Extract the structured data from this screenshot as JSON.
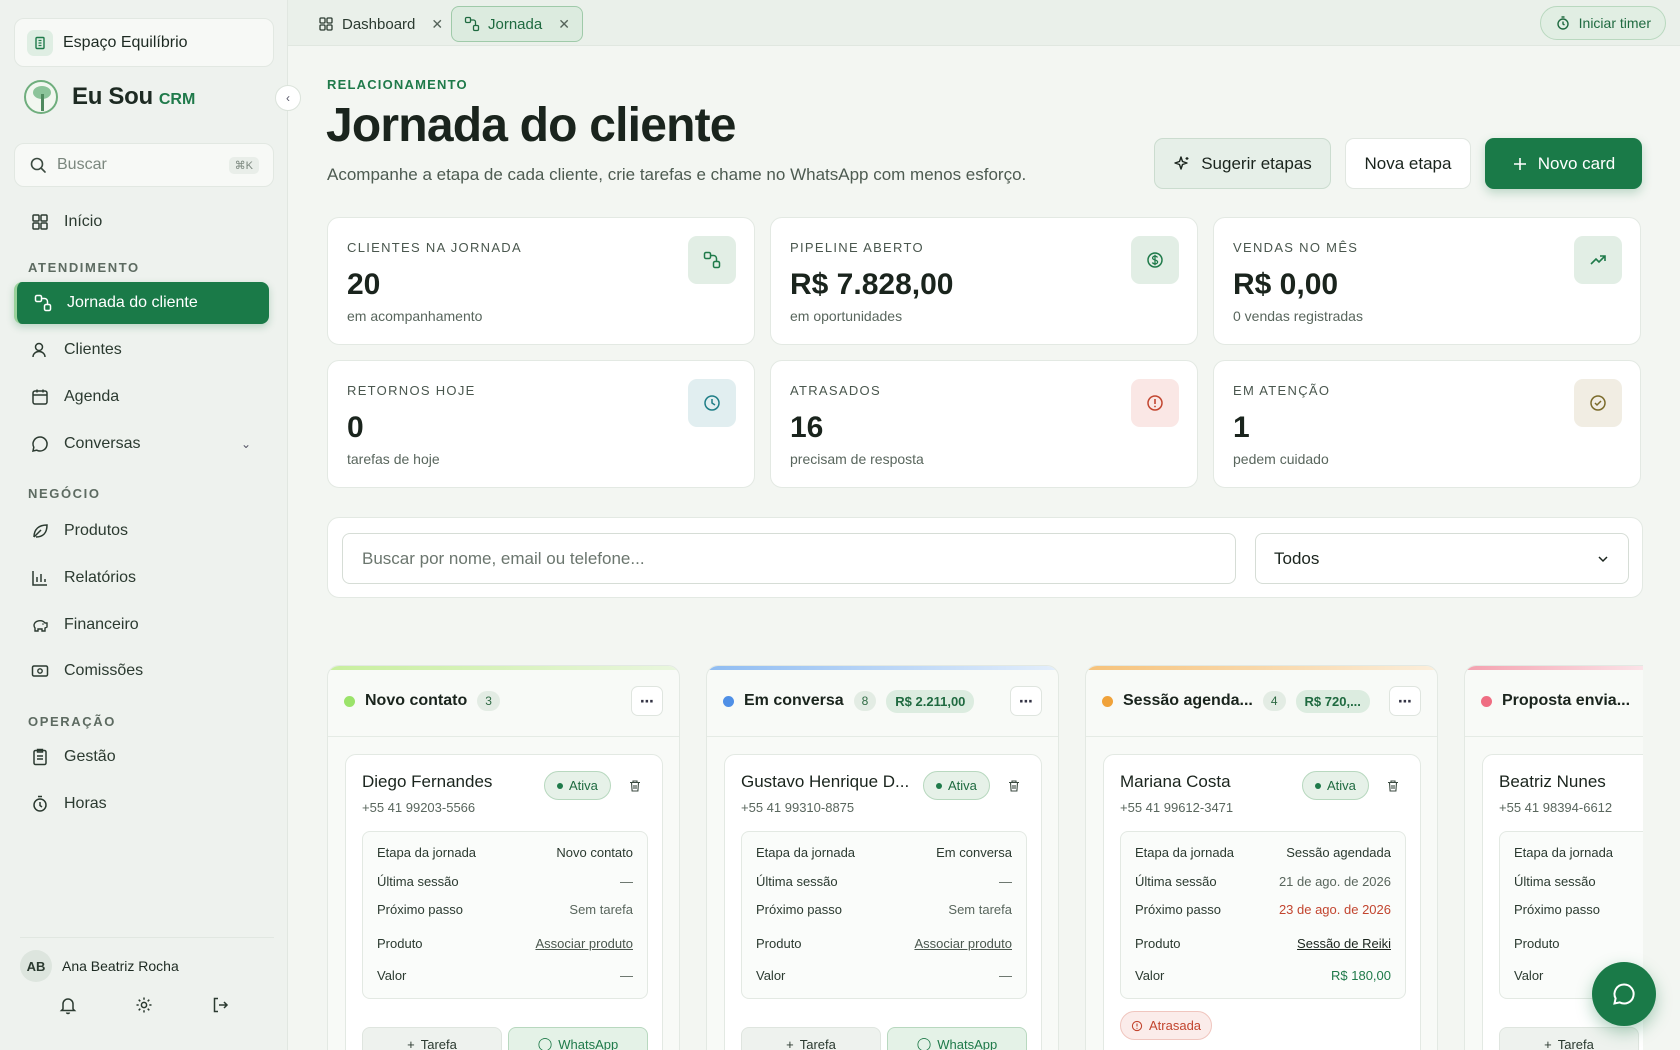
{
  "workspace": {
    "name": "Espaço Equilíbrio"
  },
  "brand": {
    "name": "Eu Sou",
    "suffix": "CRM"
  },
  "search": {
    "placeholder": "Buscar",
    "shortcut": "⌘K"
  },
  "sidebar": {
    "home": "Início",
    "section_atendimento": "ATENDIMENTO",
    "items_atendimento": [
      "Jornada do cliente",
      "Clientes",
      "Agenda",
      "Conversas"
    ],
    "section_negocio": "NEGÓCIO",
    "items_negocio": [
      "Produtos",
      "Relatórios",
      "Financeiro",
      "Comissões"
    ],
    "section_operacao": "OPERAÇÃO",
    "items_operacao": [
      "Gestão",
      "Horas"
    ],
    "active_item": "Jornada do cliente"
  },
  "user": {
    "initials": "AB",
    "name": "Ana Beatriz Rocha"
  },
  "tabs": [
    {
      "label": "Dashboard",
      "icon": "dashboard-icon"
    },
    {
      "label": "Jornada",
      "icon": "journey-icon",
      "active": true
    }
  ],
  "timer": {
    "label": "Iniciar timer"
  },
  "header": {
    "eyebrow": "RELACIONAMENTO",
    "title": "Jornada do cliente",
    "subtitle": "Acompanhe a etapa de cada cliente, crie tarefas e chame no WhatsApp com menos esforço.",
    "suggest_label": "Sugerir etapas",
    "new_stage_label": "Nova etapa",
    "new_card_label": "Novo card"
  },
  "stats": [
    {
      "label": "CLIENTES NA JORNADA",
      "value": "20",
      "sub": "em acompanhamento",
      "icon": "journey-icon"
    },
    {
      "label": "PIPELINE ABERTO",
      "value": "R$ 7.828,00",
      "sub": "em oportunidades",
      "icon": "dollar-icon"
    },
    {
      "label": "VENDAS NO MÊS",
      "value": "R$ 0,00",
      "sub": "0 vendas registradas",
      "icon": "trending-up-icon"
    },
    {
      "label": "RETORNOS HOJE",
      "value": "0",
      "sub": "tarefas de hoje",
      "icon": "clock-icon"
    },
    {
      "label": "ATRASADOS",
      "value": "16",
      "sub": "precisam de resposta",
      "icon": "alert-icon"
    },
    {
      "label": "EM ATENÇÃO",
      "value": "1",
      "sub": "pedem cuidado",
      "icon": "check-circle-icon"
    }
  ],
  "filters": {
    "search_placeholder": "Buscar por nome, email ou telefone...",
    "status_value": "Todos"
  },
  "columns": [
    {
      "title": "Novo contato",
      "count": "3",
      "amount": "",
      "color": "#9be36a",
      "card": {
        "name": "Diego Fernandes",
        "phone": "+55 41 99203-5566",
        "status": "Ativa",
        "rows": {
          "stage_label": "Etapa da jornada",
          "stage": "Novo contato",
          "last_label": "Última sessão",
          "last": "—",
          "next_label": "Próximo passo",
          "next": "Sem tarefa",
          "product_label": "Produto",
          "product": "Associar produto",
          "value_label": "Valor",
          "value": "—"
        },
        "task_label": "Tarefa",
        "whatsapp_label": "WhatsApp"
      }
    },
    {
      "title": "Em conversa",
      "count": "8",
      "amount": "R$ 2.211,00",
      "color": "#4f8fe6",
      "card": {
        "name": "Gustavo Henrique D...",
        "phone": "+55 41 99310-8875",
        "status": "Ativa",
        "rows": {
          "stage_label": "Etapa da jornada",
          "stage": "Em conversa",
          "last_label": "Última sessão",
          "last": "—",
          "next_label": "Próximo passo",
          "next": "Sem tarefa",
          "product_label": "Produto",
          "product": "Associar produto",
          "value_label": "Valor",
          "value": "—"
        },
        "task_label": "Tarefa",
        "whatsapp_label": "WhatsApp"
      }
    },
    {
      "title": "Sessão agenda...",
      "count": "4",
      "amount": "R$ 720,...",
      "color": "#f0a23a",
      "card": {
        "name": "Mariana Costa",
        "phone": "+55 41 99612-3471",
        "status": "Ativa",
        "rows": {
          "stage_label": "Etapa da jornada",
          "stage": "Sessão agendada",
          "last_label": "Última sessão",
          "last": "21 de ago. de 2026",
          "next_label": "Próximo passo",
          "next": "23 de ago. de 2026",
          "product_label": "Produto",
          "product": "Sessão de Reiki",
          "value_label": "Valor",
          "value": "R$ 180,00"
        },
        "late_label": "Atrasada"
      }
    },
    {
      "title": "Proposta envia...",
      "count": "",
      "amount": "",
      "color": "#ef6d82",
      "card": {
        "name": "Beatriz Nunes",
        "phone": "+55 41 98394-6612",
        "rows": {
          "stage_label": "Etapa da jornada",
          "last_label": "Última sessão",
          "next_label": "Próximo passo",
          "product_label": "Produto",
          "value_label": "Valor"
        },
        "task_label": "Tarefa"
      }
    }
  ],
  "colors": {
    "primary": "#1a7a48",
    "danger": "#c2452f",
    "background": "#f3f6f2"
  }
}
